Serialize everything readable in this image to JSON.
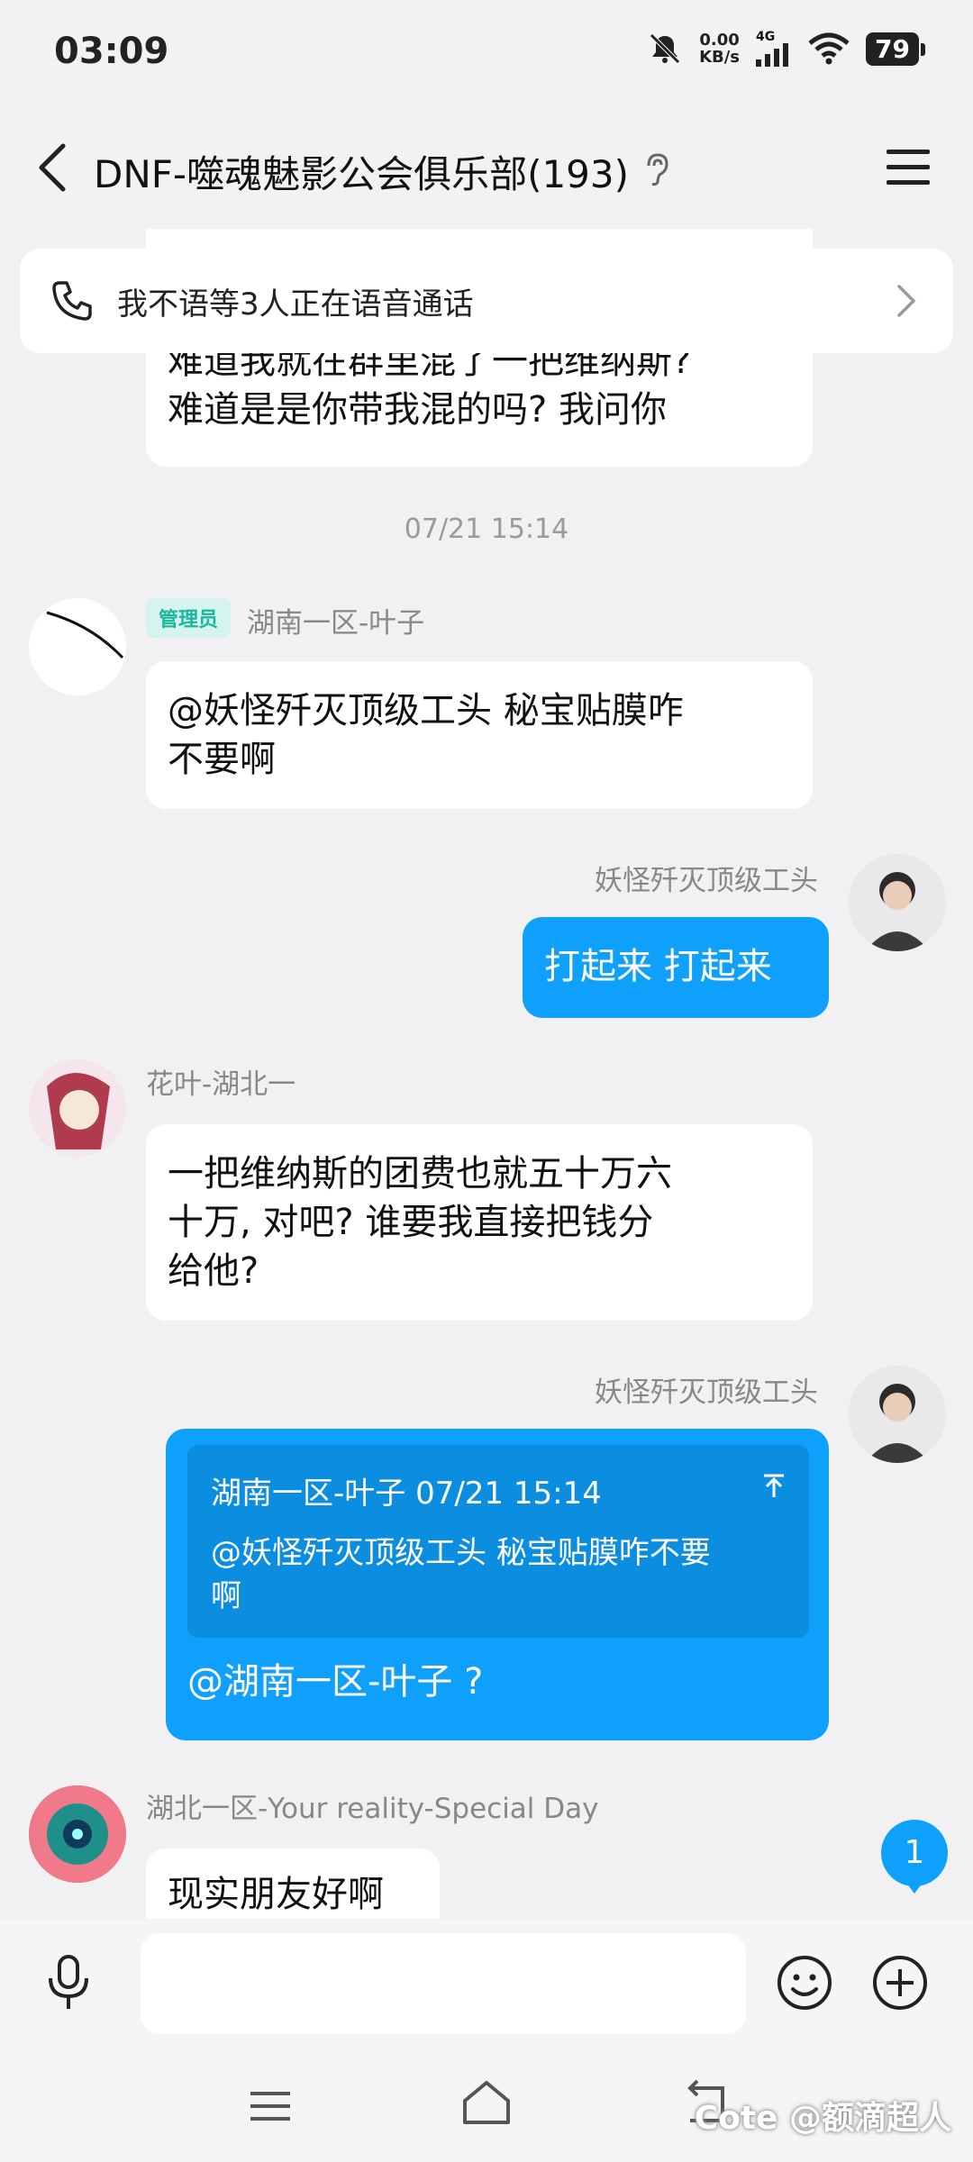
{
  "status_bar": {
    "time": "03:09",
    "net_speed_value": "0.00",
    "net_speed_unit": "KB/s",
    "network": "4G",
    "battery": "79",
    "icons": [
      "mute-bell-icon",
      "signal-icon",
      "wifi-icon",
      "battery-icon"
    ]
  },
  "header": {
    "title": "DNF-噬魂魅影公会俱乐部(193)",
    "icons": [
      "back-icon",
      "ear-icon",
      "menu-icon"
    ]
  },
  "voice_call": {
    "text": "我不语等3人正在语音通话"
  },
  "messages": {
    "m0": {
      "lines": [
        "难道我就在群里混了一把维纳斯?",
        "难道是是你带我混的吗? 我问你"
      ]
    },
    "timestamp": "07/21 15:14",
    "m1": {
      "badge": "管理员",
      "sender": "湖南一区-叶子",
      "lines": [
        "@妖怪歼灭顶级工头 秘宝贴膜咋",
        "不要啊"
      ]
    },
    "m2": {
      "sender": "妖怪歼灭顶级工头",
      "text": "打起来 打起来"
    },
    "m3": {
      "sender": "花叶-湖北一",
      "lines": [
        "一把维纳斯的团费也就五十万六",
        "十万, 对吧? 谁要我直接把钱分",
        "给他?"
      ]
    },
    "m4": {
      "sender": "妖怪歼灭顶级工头",
      "quote_header": "湖南一区-叶子 07/21 15:14",
      "quote_lines": [
        "@妖怪歼灭顶级工头 秘宝贴膜咋不要",
        "啊"
      ],
      "text": "@湖南一区-叶子 ?"
    },
    "m5": {
      "sender": "湖北一区-Your reality-Special Day",
      "text": "现实朋友好啊"
    }
  },
  "unread_count": "1",
  "input": {
    "placeholder": ""
  },
  "watermark": "Cote @额滴超人",
  "colors": {
    "accent": "#0ea0fb",
    "admin_badge": "#1bb79c"
  }
}
